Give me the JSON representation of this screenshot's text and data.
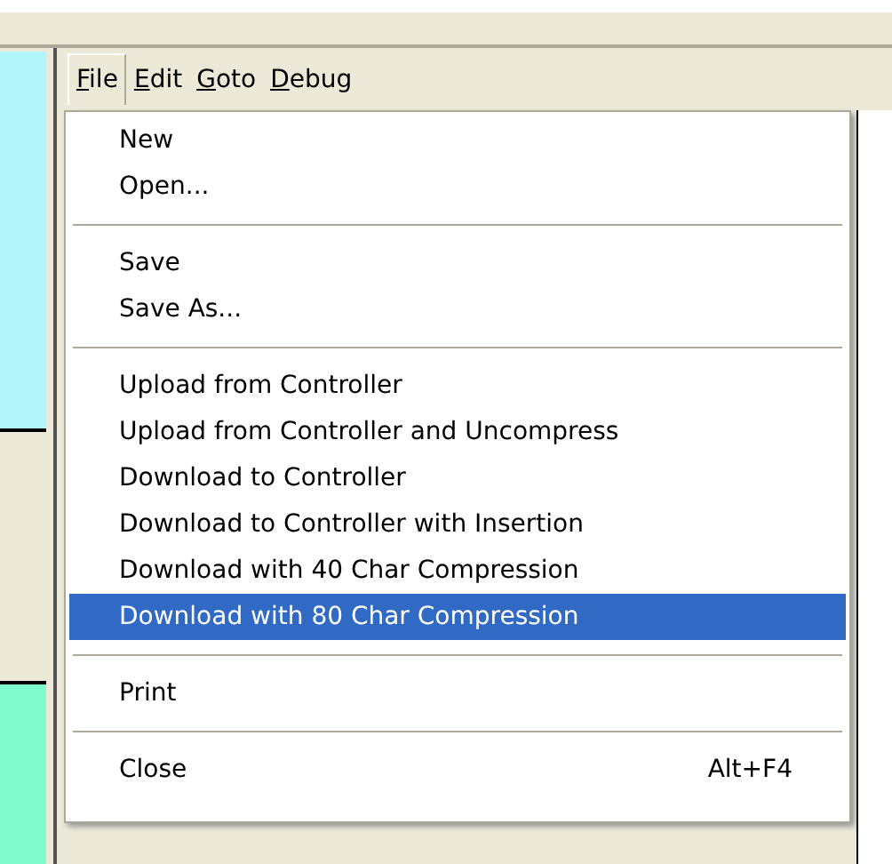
{
  "menu_bar": [
    {
      "label": "File",
      "selected": true
    },
    {
      "label": "Edit",
      "selected": false
    },
    {
      "label": "Goto",
      "selected": false
    },
    {
      "label": "Debug",
      "selected": false
    }
  ],
  "file_menu": {
    "groups": [
      [
        {
          "label": "New",
          "selected": false
        },
        {
          "label": "Open...",
          "selected": false
        }
      ],
      [
        {
          "label": "Save",
          "selected": false
        },
        {
          "label": "Save As...",
          "selected": false
        }
      ],
      [
        {
          "label": "Upload from Controller",
          "selected": false
        },
        {
          "label": "Upload from Controller and Uncompress",
          "selected": false
        },
        {
          "label": "Download to Controller",
          "selected": false
        },
        {
          "label": "Download to Controller with Insertion",
          "selected": false
        },
        {
          "label": "Download with 40 Char Compression",
          "selected": false
        },
        {
          "label": "Download with 80 Char Compression",
          "selected": true
        }
      ],
      [
        {
          "label": "Print",
          "selected": false
        }
      ],
      [
        {
          "label": "Close",
          "shortcut": "Alt+F4",
          "selected": false
        }
      ]
    ]
  }
}
